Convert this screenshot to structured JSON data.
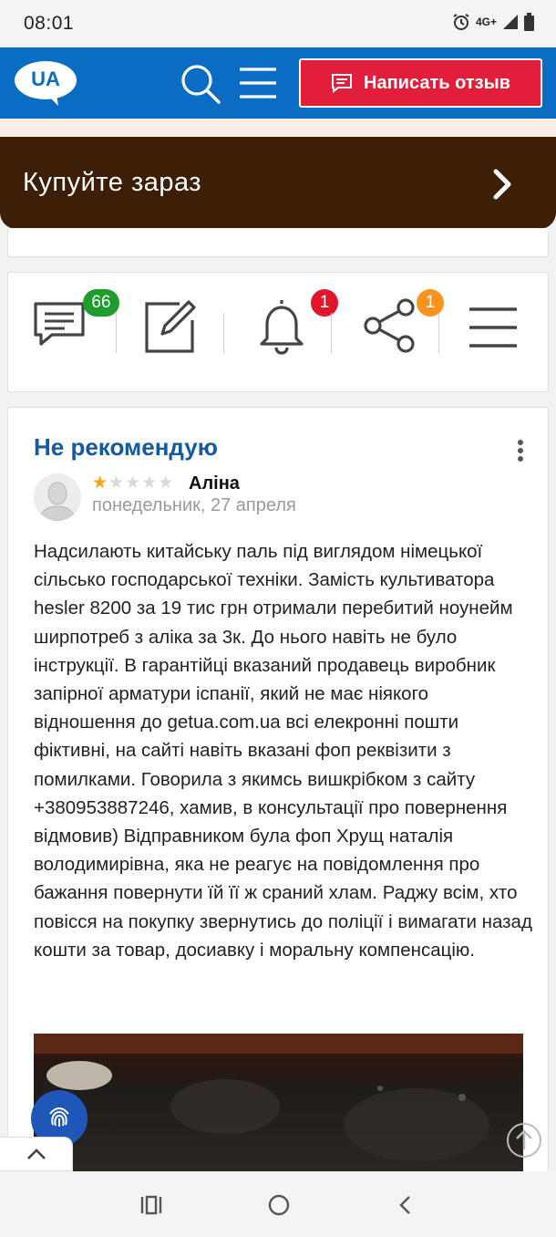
{
  "status_bar": {
    "time": "08:01",
    "network": "4G+"
  },
  "header": {
    "logo_text": "UA",
    "write_review_label": "Написать отзыв",
    "brand_color": "#0a6cc2",
    "button_color": "#e31e3a"
  },
  "banner": {
    "text": "Купуйте зараз",
    "color": "#3d1f07"
  },
  "actions": {
    "comments_count": "66",
    "notifications_count": "1",
    "share_count": "1",
    "icons": [
      "comment-icon",
      "edit-icon",
      "bell-icon",
      "share-icon",
      "menu-icon"
    ]
  },
  "review": {
    "title": "Не рекомендую",
    "rating": 1,
    "rating_max": 5,
    "author": "Аліна",
    "date": "понедельник, 27 апреля",
    "text": "Надсилають китайську паль під виглядом німецької сільсько господарської техніки. Замість культиватора hesler 8200 за 19 тис грн отримали перебитий ноунейм ширпотреб з аліка за 3к. До нього навіть не було інструкції. В гарантійці вказаний продавець виробник запірної арматури іспанії, який не має ніякого відношення до getua.com.ua всі елекронні пошти фіктивні, на сайті навіть вказані фоп реквізити з помилками. Говорила з якимсь вишкрібком з сайту +380953887246, хамив, в консультації про повернення відмовив) Відправником була фоп Хрущ наталія володимирівна, яка не реагує на повідомлення про бажання повернути їй її ж сраний хлам. Раджу всім, хто повісся на покупку звернутись до поліції і вимагати назад кошти за товар, досиавку і моральну компенсацію."
  },
  "nav_bar": {
    "icons": [
      "recents-icon",
      "home-icon",
      "back-icon"
    ]
  }
}
